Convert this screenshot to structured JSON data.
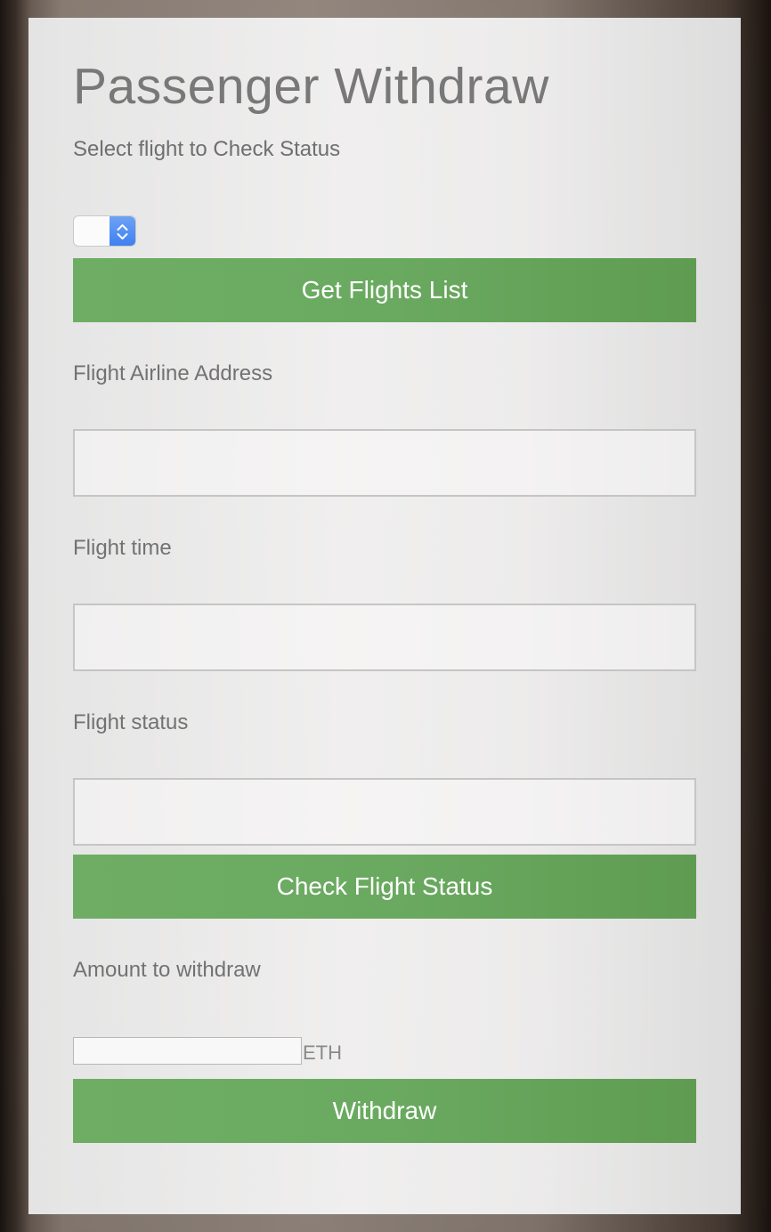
{
  "form": {
    "title": "Passenger Withdraw",
    "select_prompt": "Select flight to Check Status",
    "flight_select": {
      "selected_value": "",
      "icon": "chevron-up-down-icon"
    },
    "get_flights_button": "Get Flights List",
    "airline_address_label": "Flight Airline Address",
    "airline_address_value": "",
    "flight_time_label": "Flight time",
    "flight_time_value": "",
    "flight_status_label": "Flight status",
    "flight_status_value": "",
    "check_status_button": "Check Flight Status",
    "amount_label": "Amount to withdraw",
    "amount_value": "",
    "amount_unit": "ETH",
    "withdraw_button": "Withdraw"
  },
  "colors": {
    "button_green": "#6aaa60",
    "select_blue": "#3c7ff0",
    "panel_bg": "#f0efef",
    "text_gray": "#727272"
  }
}
